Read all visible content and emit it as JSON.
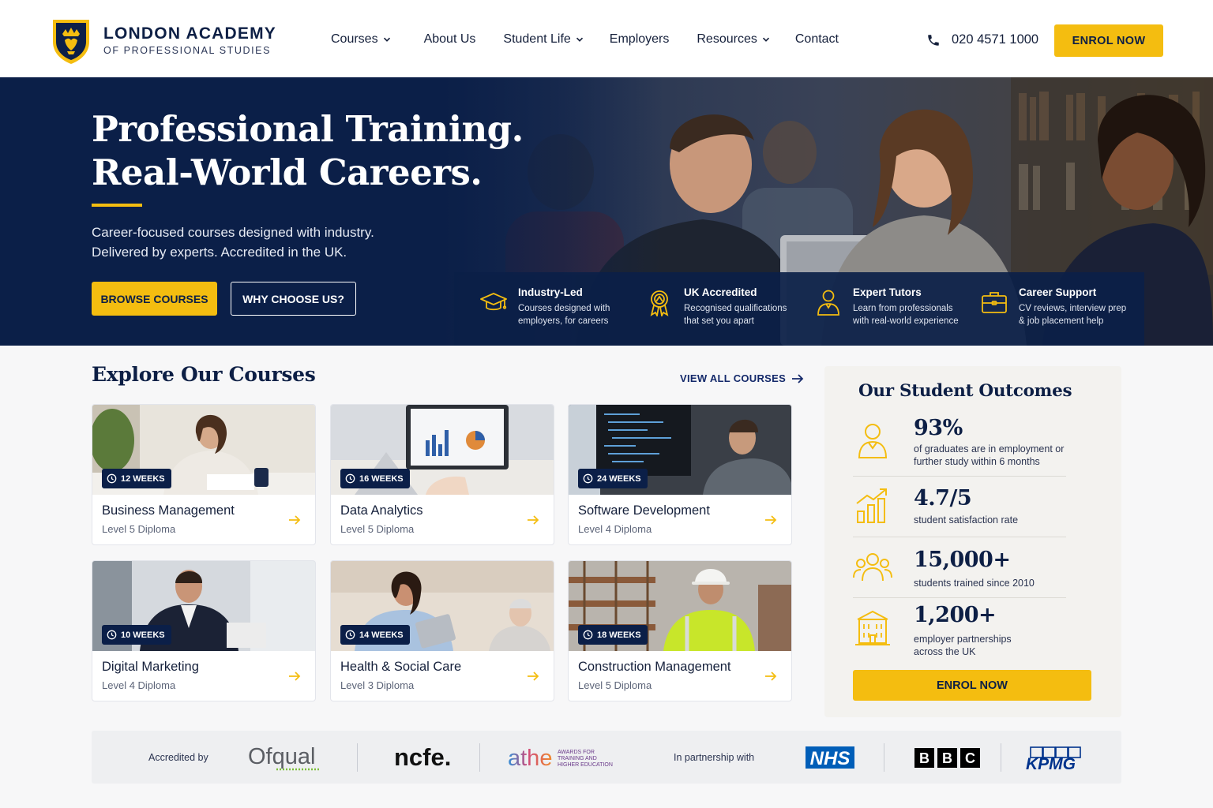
{
  "brand": {
    "title": "LONDON ACADEMY",
    "subtitle": "OF PROFESSIONAL STUDIES",
    "accent_color": "#f4bd10",
    "navy_color": "#0b1f48"
  },
  "nav": {
    "items": [
      {
        "label": "Courses",
        "has_dropdown": true
      },
      {
        "label": "About Us",
        "has_dropdown": false
      },
      {
        "label": "Student Life",
        "has_dropdown": true
      },
      {
        "label": "Employers",
        "has_dropdown": false
      },
      {
        "label": "Resources",
        "has_dropdown": true
      },
      {
        "label": "Contact",
        "has_dropdown": false
      }
    ],
    "phone": "020 4571 1000",
    "enrol_label": "ENROL NOW"
  },
  "hero": {
    "title_line1": "Professional Training.",
    "title_line2": "Real-World Careers.",
    "subtitle_line1": "Career-focused courses designed with industry.",
    "subtitle_line2": "Delivered by experts. Accredited in the UK.",
    "primary_button": "BROWSE COURSES",
    "secondary_button": "WHY CHOOSE US?",
    "features": [
      {
        "icon": "graduation-cap-icon",
        "title": "Industry-Led",
        "desc": "Courses designed with employers, for careers"
      },
      {
        "icon": "award-medal-icon",
        "title": "UK Accredited",
        "desc": "Recognised qualifications that set you apart"
      },
      {
        "icon": "tutor-person-icon",
        "title": "Expert Tutors",
        "desc": "Learn from professionals with real-world experience"
      },
      {
        "icon": "briefcase-icon",
        "title": "Career Support",
        "desc": "CV reviews, interview prep & job placement help"
      }
    ]
  },
  "courses": {
    "title": "Explore Our Courses",
    "view_all": "VIEW ALL COURSES",
    "items": [
      {
        "name": "Business Management",
        "level": "Level 5 Diploma",
        "duration": "12 WEEKS"
      },
      {
        "name": "Data Analytics",
        "level": "Level 5 Diploma",
        "duration": "16 WEEKS"
      },
      {
        "name": "Software Development",
        "level": "Level 4 Diploma",
        "duration": "24 WEEKS"
      },
      {
        "name": "Digital Marketing",
        "level": "Level 4 Diploma",
        "duration": "10 WEEKS"
      },
      {
        "name": "Health & Social Care",
        "level": "Level 3 Diploma",
        "duration": "14 WEEKS"
      },
      {
        "name": "Construction Management",
        "level": "Level 5 Diploma",
        "duration": "18 WEEKS"
      }
    ]
  },
  "outcomes": {
    "title": "Our Student Outcomes",
    "stats": [
      {
        "icon": "graduate-person-icon",
        "value": "93%",
        "desc": "of graduates are in employment or further study within 6 months"
      },
      {
        "icon": "growth-chart-icon",
        "value": "4.7/5",
        "desc": "student satisfaction rate"
      },
      {
        "icon": "group-people-icon",
        "value": "15,000+",
        "desc": "students trained since 2010"
      },
      {
        "icon": "building-icon",
        "value": "1,200+",
        "desc": "employer partnerships across the UK"
      }
    ],
    "enrol_label": "ENROL NOW"
  },
  "partners": {
    "accredited_label": "Accredited by",
    "partnership_label": "In partnership with",
    "accreditors": [
      "Ofqual",
      "ncfe.",
      "athe"
    ],
    "athe_tagline": "AWARDS FOR TRAINING AND HIGHER EDUCATION",
    "partner_logos": [
      "NHS",
      "BBC",
      "KPMG"
    ]
  }
}
